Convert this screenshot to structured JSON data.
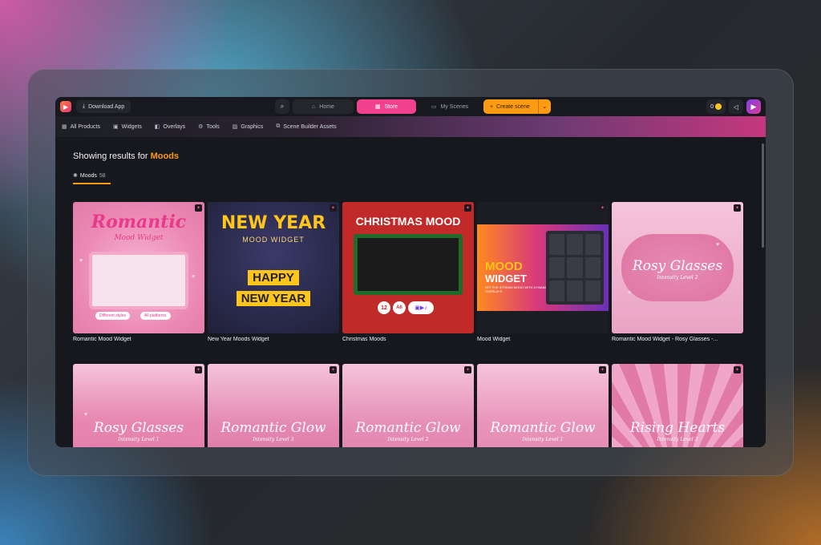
{
  "topbar": {
    "download_label": "Download App",
    "nav": {
      "home": "Home",
      "store": "Store",
      "my_scenes": "My Scenes",
      "create": "Create scene"
    },
    "coins": "0"
  },
  "categories": [
    {
      "label": "All Products",
      "icon": "grid-icon"
    },
    {
      "label": "Widgets",
      "icon": "widget-icon"
    },
    {
      "label": "Overlays",
      "icon": "overlay-icon"
    },
    {
      "label": "Tools",
      "icon": "gear-icon"
    },
    {
      "label": "Graphics",
      "icon": "image-icon"
    },
    {
      "label": "Scene Builder Assets",
      "icon": "scene-icon"
    }
  ],
  "results": {
    "prefix": "Showing results for",
    "query": "Moods"
  },
  "tab": {
    "label": "Moods",
    "count": "58"
  },
  "cards": [
    {
      "title": "Romantic Mood Widget",
      "art_title": "Romantic",
      "art_sub": "Mood Widget",
      "chip1": "Different styles",
      "chip2": "All platforms"
    },
    {
      "title": "New Year Moods Widget",
      "art_title": "NEW YEAR",
      "art_sub": "MOOD WIDGET",
      "banner1": "HAPPY",
      "banner2": "NEW YEAR"
    },
    {
      "title": "Christmas Moods",
      "art_title": "CHRISTMAS MOOD",
      "badge_num": "12",
      "badge_all": "All"
    },
    {
      "title": "Mood Widget",
      "art_title": "MOOD",
      "art_title2": "WIDGET",
      "art_sub": "SET THE STREAM MOOD WITH DYNAMIC OVERLAYS"
    },
    {
      "title": "Romantic Mood Widget - Rosy Glasses -...",
      "art_title": "Rosy Glasses",
      "art_sub": "Intensity Level 2"
    },
    {
      "title": "",
      "art_title": "Rosy Glasses",
      "art_sub": "Intensity Level 1"
    },
    {
      "title": "",
      "art_title": "Romantic Glow",
      "art_sub": "Intensity Level 3"
    },
    {
      "title": "",
      "art_title": "Romantic Glow",
      "art_sub": "Intensity Level 2"
    },
    {
      "title": "",
      "art_title": "Romantic Glow",
      "art_sub": "Intensity Level 1"
    },
    {
      "title": "",
      "art_title": "Rising Hearts",
      "art_sub": "Intensity Level 3"
    }
  ],
  "colors": {
    "accent": "#ff9b12",
    "store": "#f2418f"
  }
}
